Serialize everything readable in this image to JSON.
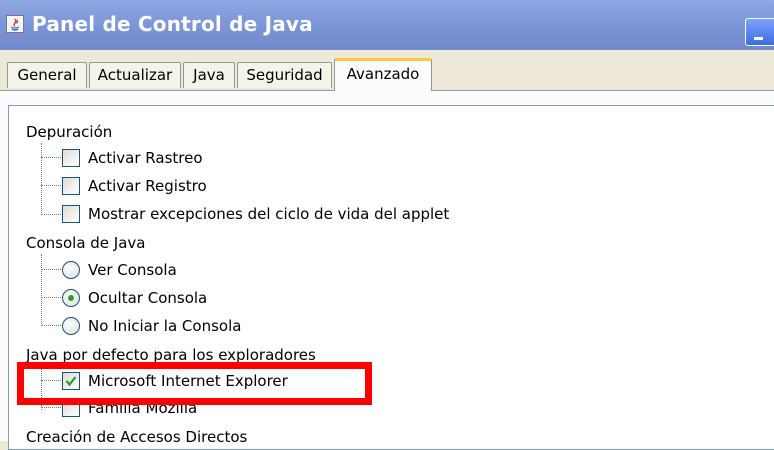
{
  "window": {
    "title": "Panel de Control de Java",
    "icon": "java-icon"
  },
  "tabs": [
    {
      "label": "General"
    },
    {
      "label": "Actualizar"
    },
    {
      "label": "Java"
    },
    {
      "label": "Seguridad"
    },
    {
      "label": "Avanzado",
      "active": true
    }
  ],
  "tree": {
    "groups": [
      {
        "label": "Depuración",
        "items": [
          {
            "label": "Activar Rastreo",
            "type": "checkbox",
            "checked": false
          },
          {
            "label": "Activar Registro",
            "type": "checkbox",
            "checked": false
          },
          {
            "label": "Mostrar excepciones del ciclo de vida del applet",
            "type": "checkbox",
            "checked": false
          }
        ]
      },
      {
        "label": "Consola de Java",
        "items": [
          {
            "label": "Ver Consola",
            "type": "radio",
            "selected": false
          },
          {
            "label": "Ocultar Consola",
            "type": "radio",
            "selected": true
          },
          {
            "label": "No Iniciar la Consola",
            "type": "radio",
            "selected": false
          }
        ]
      },
      {
        "label": "Java por defecto para los exploradores",
        "items": [
          {
            "label": "Microsoft Internet Explorer",
            "type": "checkbox",
            "checked": true
          },
          {
            "label": "Familia Mozilla",
            "type": "checkbox",
            "checked": false
          }
        ]
      },
      {
        "label": "Creación de Accesos Directos",
        "items": []
      }
    ]
  },
  "annotation": {
    "color": "#ff0000"
  }
}
